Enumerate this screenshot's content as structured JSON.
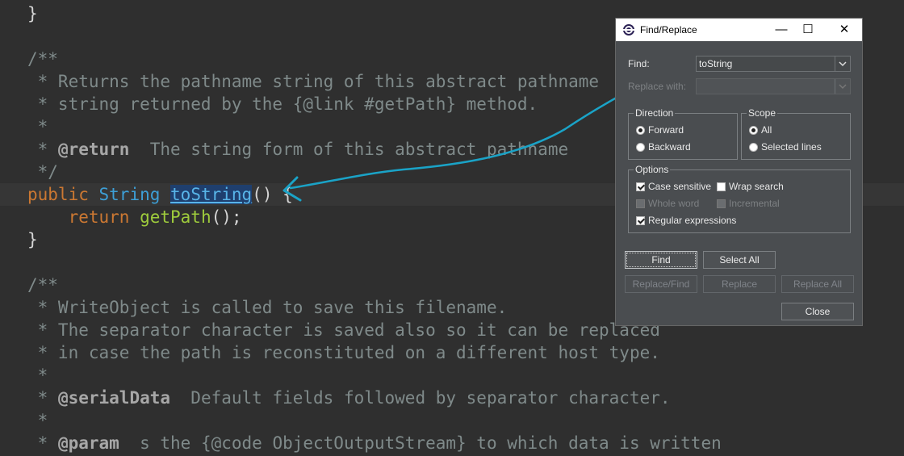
{
  "editor": {
    "lines": [
      [
        {
          "t": "}",
          "c": "plain"
        }
      ],
      [
        {
          "t": "",
          "c": "plain"
        }
      ],
      [
        {
          "t": "/**",
          "c": "comment"
        }
      ],
      [
        {
          "t": " * Returns the pathname string of this abstract pathname",
          "c": "comment"
        }
      ],
      [
        {
          "t": " * string returned by the {@link #getPath} method.",
          "c": "comment"
        }
      ],
      [
        {
          "t": " *",
          "c": "comment"
        }
      ],
      [
        {
          "t": " * ",
          "c": "comment"
        },
        {
          "t": "@return",
          "c": "tag"
        },
        {
          "t": "  The string form of this abstract pathname",
          "c": "comment"
        }
      ],
      [
        {
          "t": " */",
          "c": "comment"
        }
      ],
      [
        {
          "t": "public ",
          "c": "kw"
        },
        {
          "t": "String ",
          "c": "type"
        },
        {
          "t": "toString",
          "c": "sel"
        },
        {
          "t": "() {",
          "c": "plain"
        }
      ],
      [
        {
          "t": "    ",
          "c": "plain"
        },
        {
          "t": "return ",
          "c": "kw"
        },
        {
          "t": "getPath",
          "c": "method"
        },
        {
          "t": "();",
          "c": "plain"
        }
      ],
      [
        {
          "t": "}",
          "c": "plain"
        }
      ],
      [
        {
          "t": "",
          "c": "plain"
        }
      ],
      [
        {
          "t": "/**",
          "c": "comment"
        }
      ],
      [
        {
          "t": " * WriteObject is called to save this filename.",
          "c": "comment"
        }
      ],
      [
        {
          "t": " * The separator character is saved also so it can be replaced",
          "c": "comment"
        }
      ],
      [
        {
          "t": " * in case the path is reconstituted on a different host type.",
          "c": "comment"
        }
      ],
      [
        {
          "t": " *",
          "c": "comment"
        }
      ],
      [
        {
          "t": " * ",
          "c": "comment"
        },
        {
          "t": "@serialData",
          "c": "tag"
        },
        {
          "t": "  Default fields followed by separator character.",
          "c": "comment"
        }
      ],
      [
        {
          "t": " *",
          "c": "comment"
        }
      ],
      [
        {
          "t": " * ",
          "c": "comment"
        },
        {
          "t": "@param",
          "c": "tag"
        },
        {
          "t": "  s the {@code ObjectOutputStream} to which data is written",
          "c": "comment"
        }
      ]
    ]
  },
  "dialog": {
    "title": "Find/Replace",
    "minimize": "—",
    "maximize": "☐",
    "close": "✕",
    "find_label": "Find:",
    "find_value": "toString",
    "replace_label": "Replace with:",
    "replace_value": "",
    "direction": {
      "title": "Direction",
      "forward": "Forward",
      "backward": "Backward",
      "selected": "forward"
    },
    "scope": {
      "title": "Scope",
      "all": "All",
      "selected_lines": "Selected lines",
      "selected": "all"
    },
    "options": {
      "title": "Options",
      "case_sensitive": "Case sensitive",
      "wrap_search": "Wrap search",
      "whole_word": "Whole word",
      "incremental": "Incremental",
      "regular_expressions": "Regular expressions"
    },
    "buttons": {
      "find": "Find",
      "select_all": "Select All",
      "replace_find": "Replace/Find",
      "replace": "Replace",
      "replace_all": "Replace All",
      "close": "Close"
    }
  },
  "colors": {
    "annotation_arrow": "#1aa3c7"
  }
}
